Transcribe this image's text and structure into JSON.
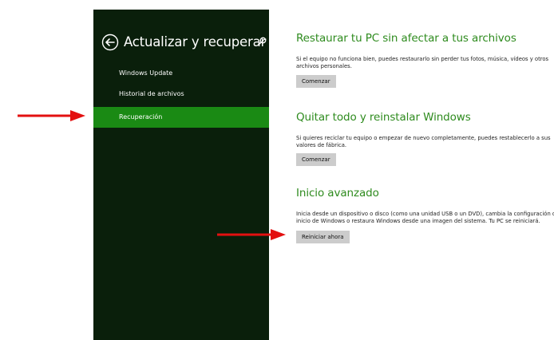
{
  "sidebar": {
    "title": "Actualizar y recuperar",
    "items": [
      {
        "label": "Windows Update"
      },
      {
        "label": "Historial de archivos"
      },
      {
        "label": "Recuperación"
      }
    ]
  },
  "sections": [
    {
      "title": "Restaurar tu PC sin afectar a tus archivos",
      "description": "Si el equipo no funciona bien, puedes restaurarlo sin perder tus fotos, música, vídeos y otros archivos personales.",
      "button": "Comenzar"
    },
    {
      "title": "Quitar todo y reinstalar Windows",
      "description": "Si quieres reciclar tu equipo o empezar de nuevo completamente, puedes restablecerlo a sus valores de fábrica.",
      "button": "Comenzar"
    },
    {
      "title": "Inicio avanzado",
      "description": "Inicia desde un dispositivo o disco (como una unidad USB o un DVD), cambia la configuración de inicio de Windows o restaura Windows desde una imagen del sistema. Tu PC se reiniciará.",
      "button": "Reiniciar ahora"
    }
  ],
  "colors": {
    "sidebar_bg": "#0a1f0b",
    "selected_item": "#1a8a14",
    "heading": "#2e8b1e",
    "button_bg": "#cccccc",
    "annotation_arrow": "#e31010"
  },
  "icons": [
    "back-arrow-icon",
    "search-icon",
    "annotation-arrow"
  ]
}
